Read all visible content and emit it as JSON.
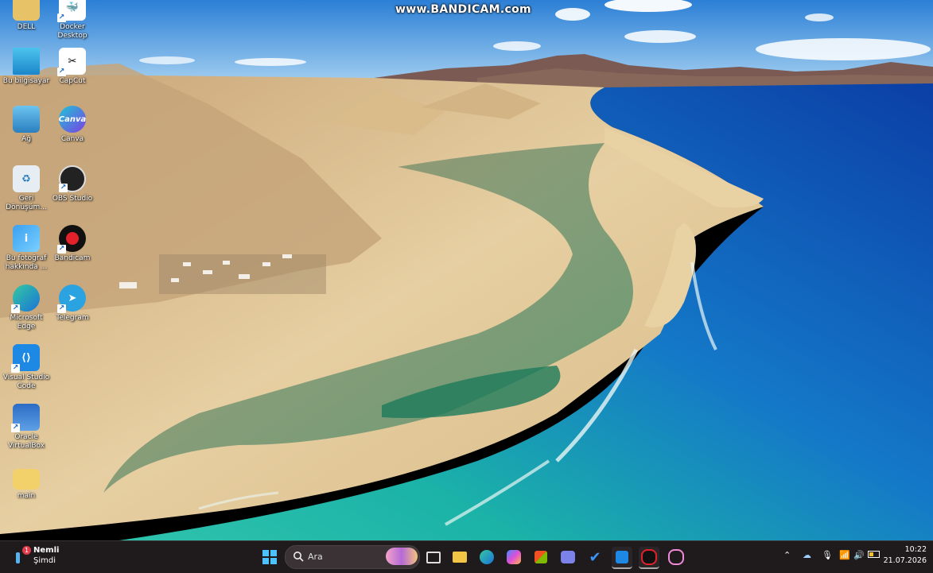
{
  "watermark": "www.BANDICAM.com",
  "desktop_icons": [
    {
      "id": "dell",
      "label": "DELL",
      "icon": "dell-folder-icon"
    },
    {
      "id": "docker",
      "label": "Docker Desktop",
      "icon": "docker-icon"
    },
    {
      "id": "this_pc",
      "label": "Bu bilgisayar",
      "icon": "computer-icon"
    },
    {
      "id": "capcut",
      "label": "CapCut",
      "icon": "capcut-icon"
    },
    {
      "id": "network",
      "label": "Ağ",
      "icon": "network-icon"
    },
    {
      "id": "canva",
      "label": "Canva",
      "icon": "canva-icon"
    },
    {
      "id": "recycle",
      "label": "Geri Dönüşüm...",
      "icon": "recycle-bin-icon"
    },
    {
      "id": "obs",
      "label": "OBS Studio",
      "icon": "obs-icon"
    },
    {
      "id": "photo",
      "label": "Bu fotoğraf hakkında ...",
      "icon": "photo-info-icon"
    },
    {
      "id": "bandicam",
      "label": "Bandicam",
      "icon": "bandicam-icon"
    },
    {
      "id": "edge",
      "label": "Microsoft Edge",
      "icon": "edge-icon"
    },
    {
      "id": "telegram",
      "label": "Telegram",
      "icon": "telegram-icon"
    },
    {
      "id": "vscode",
      "label": "Visual Studio Code",
      "icon": "vscode-icon"
    },
    {
      "id": "virtualbox",
      "label": "Oracle VirtualBox",
      "icon": "virtualbox-icon"
    },
    {
      "id": "main",
      "label": "main",
      "icon": "folder-icon"
    }
  ],
  "taskbar": {
    "weather": {
      "badge": "1",
      "title": "Nemli",
      "subtitle": "Şimdi"
    },
    "search_placeholder": "Ara",
    "apps": [
      "start-icon",
      "task-view-icon",
      "file-explorer-icon",
      "edge-icon",
      "copilot-icon",
      "store-icon",
      "teams-icon",
      "todo-icon",
      "vscode-icon",
      "bandicam-icon",
      "media-player-icon"
    ],
    "clock": {
      "time": "10:22",
      "date": "21.07.2026"
    }
  },
  "colors": {
    "sea_deep": "#1456b8",
    "sea_turquoise": "#19b6a8",
    "sand": "#e2c590",
    "taskbar": "#1f1a1c"
  }
}
